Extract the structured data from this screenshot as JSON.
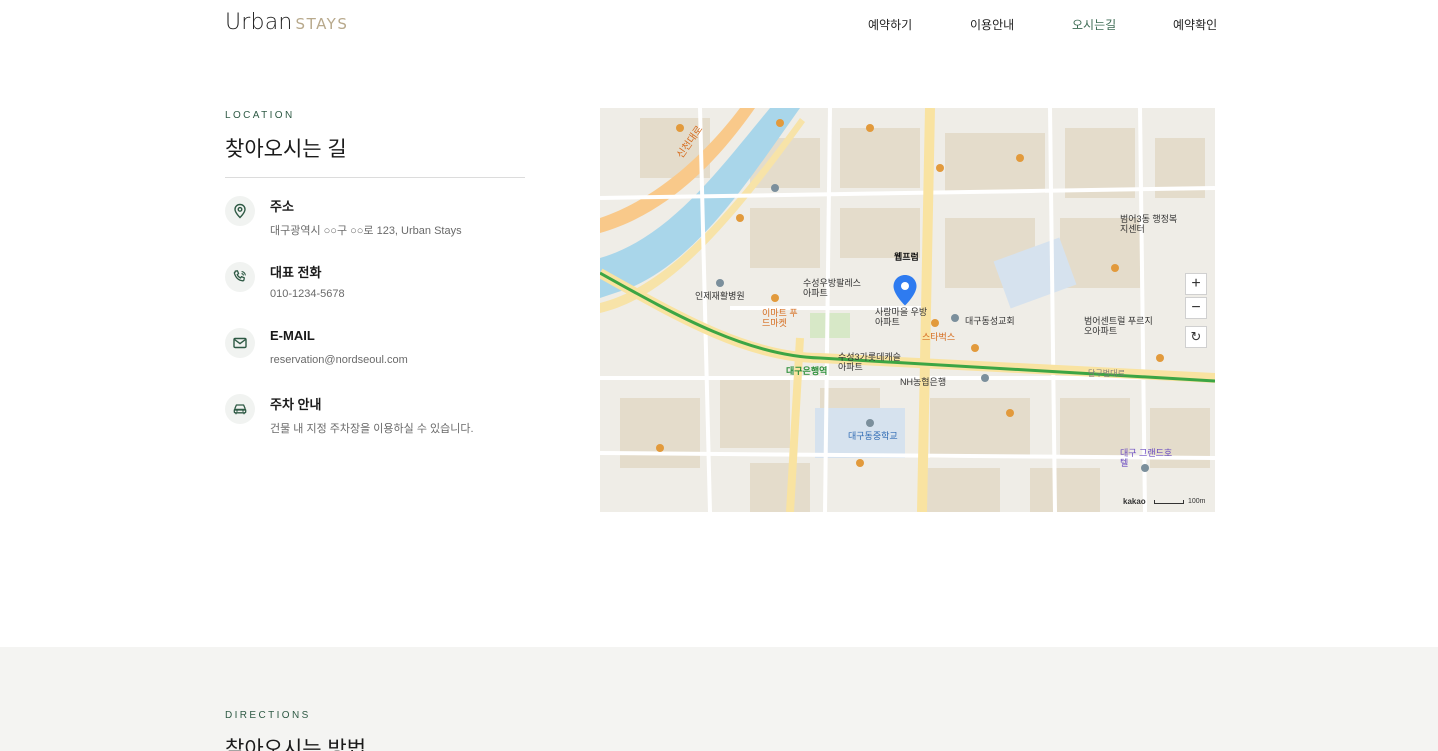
{
  "header": {
    "logo_main": "Urban",
    "logo_sub": "STAYS",
    "nav": [
      {
        "label": "예약하기"
      },
      {
        "label": "이용안내"
      },
      {
        "label": "오시는길"
      },
      {
        "label": "예약확인"
      }
    ]
  },
  "location": {
    "eyebrow": "LOCATION",
    "title": "찾아오시는 길",
    "items": [
      {
        "label": "주소",
        "value": "대구광역시 ○○구 ○○로 123, Urban Stays",
        "icon": "map-pin-icon"
      },
      {
        "label": "대표 전화",
        "value": "010-1234-5678",
        "icon": "phone-icon"
      },
      {
        "label": "E-MAIL",
        "value": "reservation@nordseoul.com",
        "icon": "mail-icon"
      },
      {
        "label": "주차 안내",
        "value": "건물 내 지정 주차장을 이용하실 수 있습니다.",
        "icon": "car-icon"
      }
    ]
  },
  "map": {
    "zoom_in": "+",
    "zoom_out": "−",
    "reset": "↻",
    "credit": "kakao",
    "scale_label": "100m",
    "marker_label": "웹프럼",
    "labels": {
      "ceon_river_road": "신천대로",
      "hospital": "인제재활병원",
      "station_label": "대구은행역",
      "school": "대구동중학교",
      "church": "대구동성교회",
      "hotel_label": "대구 그랜드호텔",
      "starbucks": "스타벅스",
      "apt_a": "수성우방팔레스 아파트",
      "apt_b": "사랑마을 우방아파트",
      "apt_c": "범어센트럴 푸르지오아파트",
      "apt_d": "수성3가롯데캐슬 아파트",
      "bank": "NH농협은행",
      "road_label": "달구벌대로",
      "emart": "이마트 푸드마켓",
      "kiosk": "범어3동 행정복지센터"
    },
    "colors": {
      "river": "#a9d6ea",
      "main_road": "#f9c98a",
      "minor_road": "#ffffff",
      "subway_line": "#3ca544",
      "block": "#e3dccc",
      "green": "#d7e8c7",
      "marker": "#2e7bf0"
    }
  },
  "directions": {
    "eyebrow": "DIRECTIONS",
    "title": "찾아오시는 방법"
  }
}
